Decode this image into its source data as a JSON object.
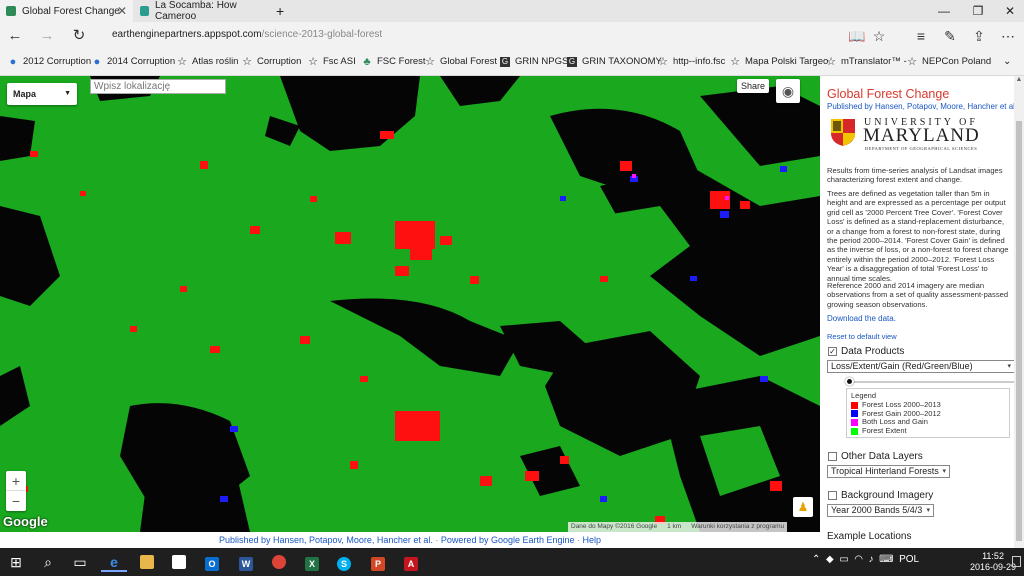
{
  "tabs": [
    {
      "label": "Global Forest Change",
      "active": true
    },
    {
      "label": "La Socamba: How Cameroo",
      "active": false
    }
  ],
  "address": {
    "host": "earthenginepartners.appspot.com",
    "path": "/science-2013-global-forest"
  },
  "favorites": [
    {
      "label": "2012 Corruption",
      "icon": "globe-icon"
    },
    {
      "label": "2014 Corruption",
      "icon": "globe-icon"
    },
    {
      "label": "Atlas roślin",
      "icon": "star-icon"
    },
    {
      "label": "Corruption",
      "icon": "star-icon"
    },
    {
      "label": "Fsc ASI",
      "icon": "star-icon"
    },
    {
      "label": "FSC Forest",
      "icon": "tree-icon"
    },
    {
      "label": "Global Forest",
      "icon": "star-icon"
    },
    {
      "label": "GRIN NPGS",
      "icon": "grin-icon"
    },
    {
      "label": "GRIN TAXONOMY",
      "icon": "grin-icon"
    },
    {
      "label": "http--info.fsc",
      "icon": "star-icon"
    },
    {
      "label": "Mapa Polski Targeo",
      "icon": "star-icon"
    },
    {
      "label": "mTranslator™ -",
      "icon": "star-icon"
    },
    {
      "label": "NEPCon Poland",
      "icon": "star-icon"
    }
  ],
  "map": {
    "type_selector": "Mapa",
    "search_placeholder": "Wpisz lokalizację",
    "share_label": "Share",
    "zoom_in": "+",
    "zoom_out": "−",
    "google_logo": "Google",
    "attribution": {
      "data": "Dane do Mapy ©2016 Google",
      "scale": "1 km",
      "terms": "Warunki korzystania z programu"
    }
  },
  "footer": {
    "published": "Published by Hansen, Potapov, Moore, Hancher et al.",
    "powered": "Powered by Google Earth Engine",
    "help": "Help"
  },
  "panel": {
    "title": "Global Forest Change",
    "authors": "Published by Hansen, Potapov, Moore, Hancher et al.",
    "logo": {
      "university": "UNIVERSITY OF",
      "name": "MARYLAND",
      "dept": "DEPARTMENT OF GEOGRAPHICAL SCIENCES"
    },
    "intro": "Results from time-series analysis of Landsat images characterizing forest extent and change.",
    "definition": "Trees are defined as vegetation taller than 5m in height and are expressed as a percentage per output grid cell as '2000 Percent Tree Cover'. 'Forest Cover Loss' is defined as a stand-replacement disturbance, or a change from a forest to non-forest state, during the period 2000–2014. 'Forest Cover Gain' is defined as the inverse of loss, or a non-forest to forest change entirely within the period 2000–2012. 'Forest Loss Year' is a disaggregation of total 'Forest Loss' to annual time scales.",
    "reference": "Reference 2000 and 2014 imagery are median observations from a set of quality assessment-passed growing season observations.",
    "download": "Download the data.",
    "reset": "Reset to default view",
    "data_products": {
      "label": "Data Products",
      "checked": true,
      "selected": "Loss/Extent/Gain (Red/Green/Blue)"
    },
    "legend": {
      "title": "Legend",
      "items": [
        {
          "label": "Forest Loss 2000–2013",
          "color": "#ff0000"
        },
        {
          "label": "Forest Gain 2000–2012",
          "color": "#0000ff"
        },
        {
          "label": "Both Loss and Gain",
          "color": "#ff00ff"
        },
        {
          "label": "Forest Extent",
          "color": "#00ff00"
        }
      ]
    },
    "other_layers": {
      "label": "Other Data Layers",
      "checked": false,
      "selected": "Tropical Hinterland Forests"
    },
    "background": {
      "label": "Background Imagery",
      "checked": false,
      "selected": "Year 2000 Bands 5/4/3"
    },
    "examples": "Example Locations"
  },
  "taskbar": {
    "language": "POL",
    "time": "11:52",
    "date": "2016-09-29"
  }
}
